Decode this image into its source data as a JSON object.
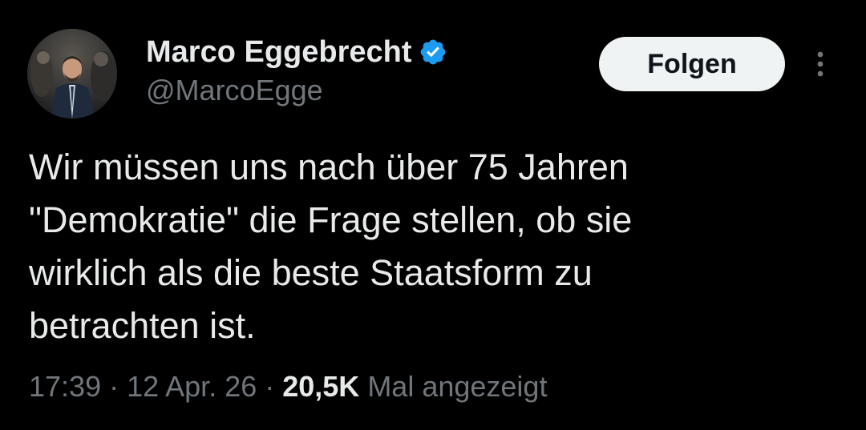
{
  "user": {
    "display_name": "Marco Eggebrecht",
    "handle": "@MarcoEgge",
    "verified_icon": "verified-badge-icon",
    "verified_color": "#1d9bf0"
  },
  "actions": {
    "follow_label": "Folgen",
    "more_icon": "more-vertical-icon"
  },
  "tweet": {
    "text": "Wir müssen uns nach über 75 Jahren\n\"Demokratie\" die Frage stellen, ob sie\nwirklich als die beste Staatsform zu\nbetrachten ist.",
    "time": "17:39",
    "separator": "·",
    "date": "12 Apr. 26",
    "views_count": "20,5K",
    "views_label": "Mal angezeigt"
  },
  "colors": {
    "background": "#000000",
    "text_primary": "#e7e9ea",
    "text_secondary": "#71767b",
    "button_bg": "#eff3f4",
    "button_text": "#0f1419"
  }
}
